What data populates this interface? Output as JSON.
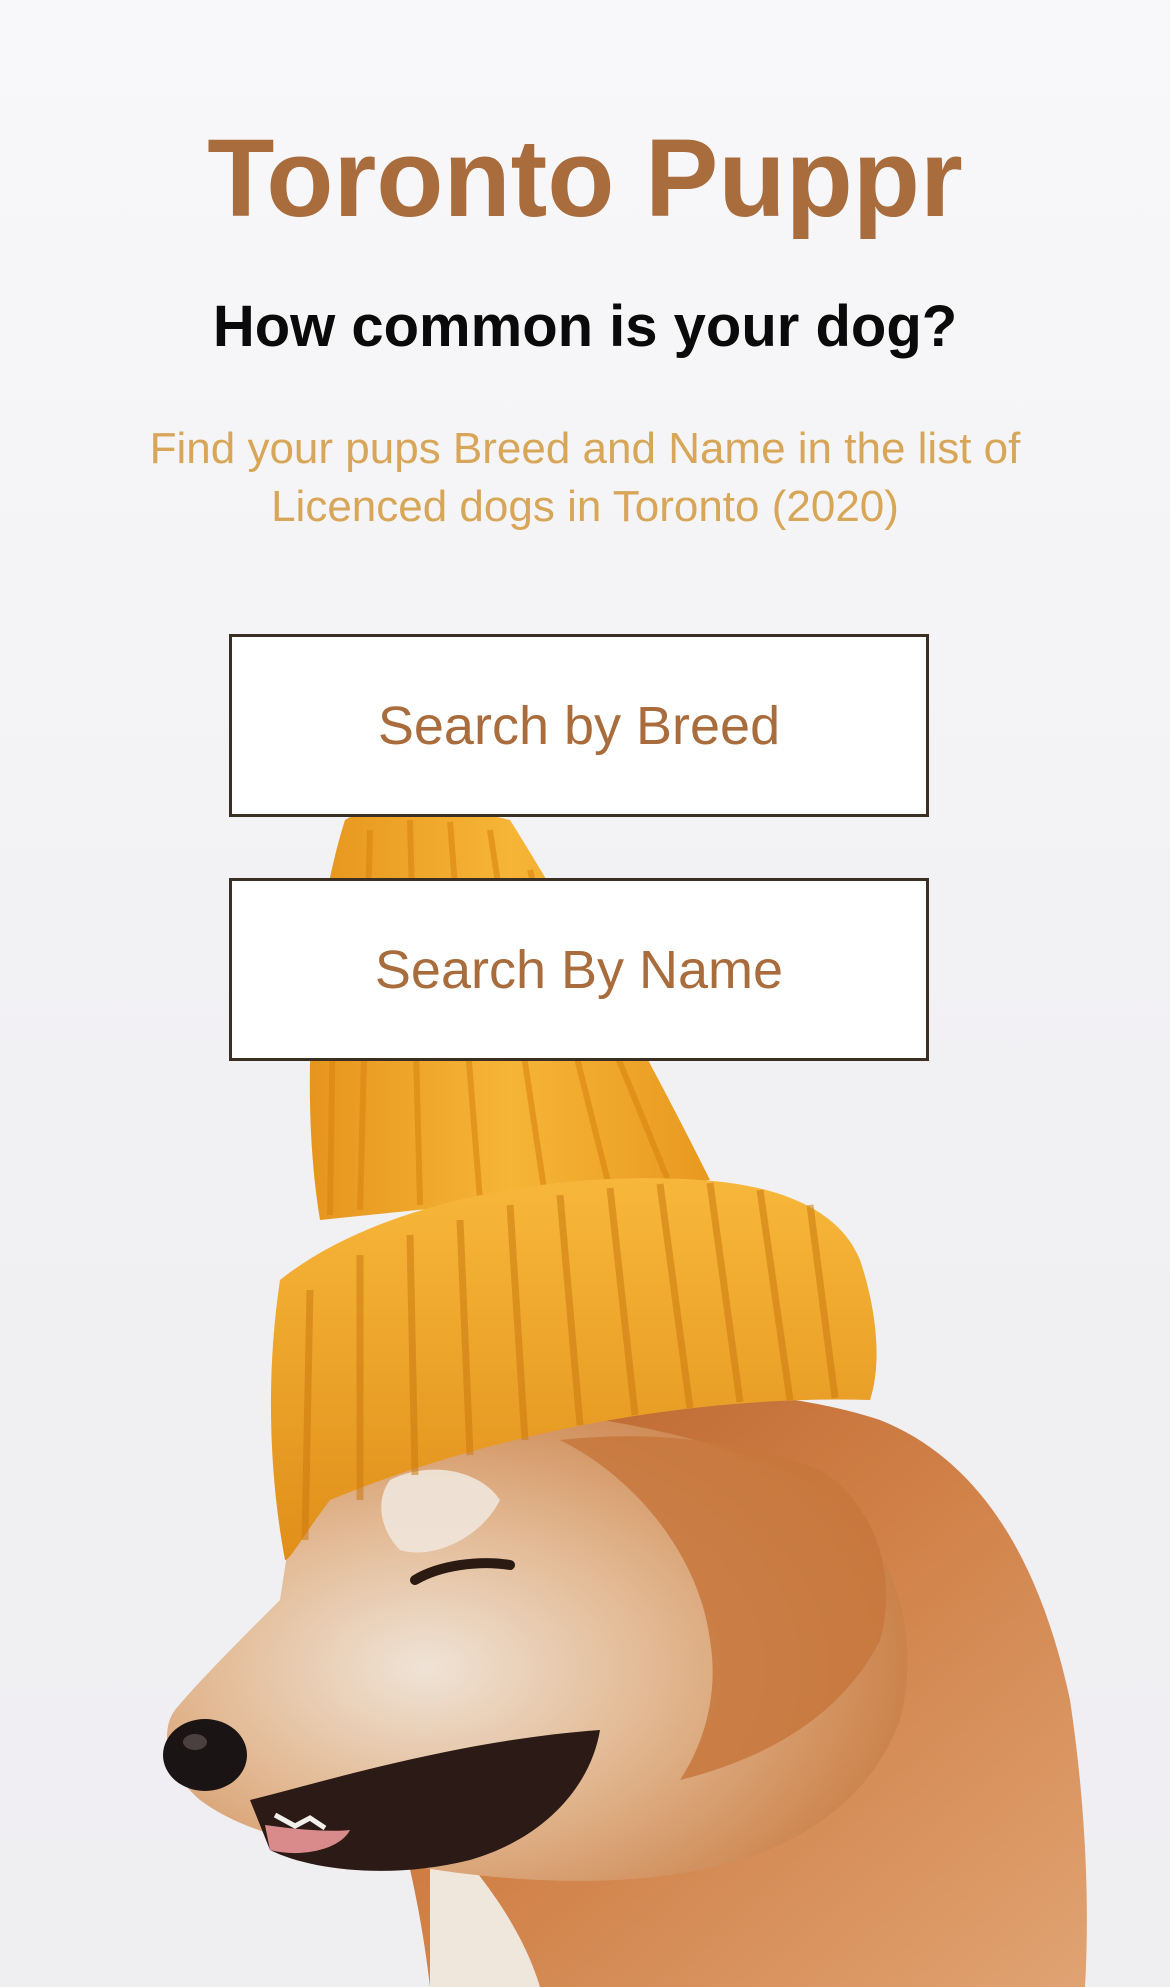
{
  "page": {
    "title": "Toronto Puppr",
    "subtitle": "How common is your dog?",
    "description": "Find your pups Breed and Name in the list of Licenced dogs in Toronto (2020)"
  },
  "actions": {
    "search_breed_label": "Search by Breed",
    "search_name_label": "Search By Name"
  },
  "colors": {
    "title": "#a86c3d",
    "subtitle": "#0a0a0a",
    "description": "#d7a659",
    "button_text": "#a86c3d",
    "button_border": "#3b2e22",
    "hat": "#f0a92b",
    "dog_fur": "#c9733a"
  }
}
